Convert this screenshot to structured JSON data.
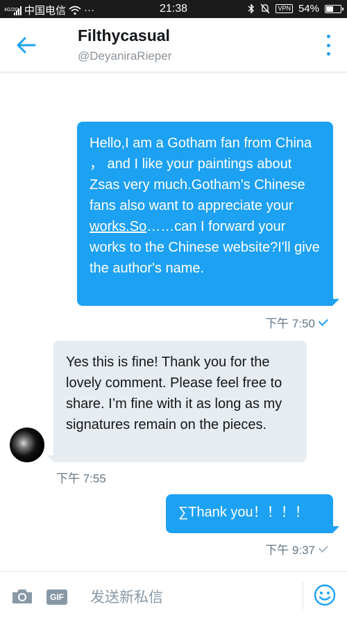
{
  "status_bar": {
    "network": "4G/2G",
    "carrier": "中国电信",
    "more": "···",
    "time": "21:38",
    "vpn": "VPN",
    "battery_text": "54%",
    "battery_level": 0.54
  },
  "header": {
    "title": "Filthycasual",
    "handle": "@DeyaniraRieper"
  },
  "messages": [
    {
      "direction": "out",
      "text_a": "Hello,I am a Gotham fan from China ， and I like your paintings about Zsas very much.Gotham's Chinese fans also want to appreciate your ",
      "text_link": "works.So",
      "text_b": "……can I forward your works to the Chinese website?I'll give the author's name.",
      "time": "下午 7:50"
    },
    {
      "direction": "in",
      "text": "Yes this is fine! Thank you for the lovely comment. Please feel free to share. I’m fine with it as long as my signatures remain on the pieces.",
      "time": "下午 7:55"
    },
    {
      "direction": "out",
      "text": "∑Thank you！！！！",
      "time": "下午 9:37"
    }
  ],
  "compose": {
    "gif_label": "GIF",
    "placeholder": "发送新私信"
  },
  "colors": {
    "accent": "#1da1f2",
    "incoming_bubble": "#e6ecf0",
    "muted_text": "#657786"
  }
}
